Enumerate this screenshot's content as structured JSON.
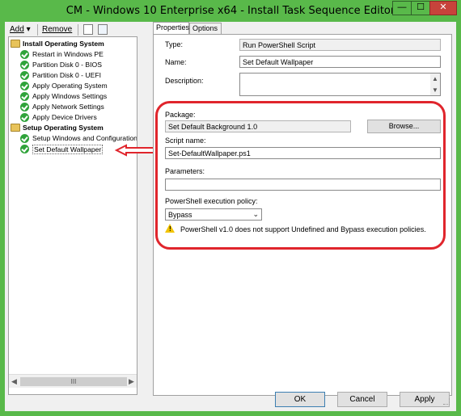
{
  "window": {
    "title": "CM - Windows 10 Enterprise x64 - Install Task Sequence Editor",
    "controls": {
      "minimize": "—",
      "maximize": "☐",
      "close": "✕"
    }
  },
  "toolbar": {
    "add_label": "Add",
    "remove_label": "Remove",
    "icons": [
      "properties-icon",
      "move-up-icon"
    ]
  },
  "tree": {
    "groups": [
      {
        "label": "Install Operating System",
        "children": [
          "Restart in Windows PE",
          "Partition Disk 0 - BIOS",
          "Partition Disk 0 - UEFI",
          "Apply Operating System",
          "Apply Windows Settings",
          "Apply Network Settings",
          "Apply Device Drivers"
        ]
      },
      {
        "label": "Setup Operating System",
        "children": [
          "Setup Windows and Configuration",
          "Set Default Wallpaper"
        ]
      }
    ],
    "scrollbar_thumb": "III"
  },
  "tabs": [
    {
      "label": "Properties",
      "active": true
    },
    {
      "label": "Options",
      "active": false
    }
  ],
  "properties": {
    "type_label": "Type:",
    "type_value": "Run PowerShell Script",
    "name_label": "Name:",
    "name_value": "Set Default Wallpaper",
    "description_label": "Description:",
    "description_value": "",
    "package_label": "Package:",
    "package_value": "Set Default Background 1.0",
    "browse_label": "Browse...",
    "script_label": "Script name:",
    "script_value": "Set-DefaultWallpaper.ps1",
    "parameters_label": "Parameters:",
    "parameters_value": "",
    "policy_label": "PowerShell execution policy:",
    "policy_value": "Bypass",
    "warning": "PowerShell v1.0 does not support Undefined and Bypass execution policies."
  },
  "buttons": {
    "ok": "OK",
    "cancel": "Cancel",
    "apply": "Apply"
  },
  "colors": {
    "frame_green": "#59b94a",
    "highlight_red": "#e0252c",
    "close_red": "#c7433b",
    "check_green": "#2fa33a"
  }
}
